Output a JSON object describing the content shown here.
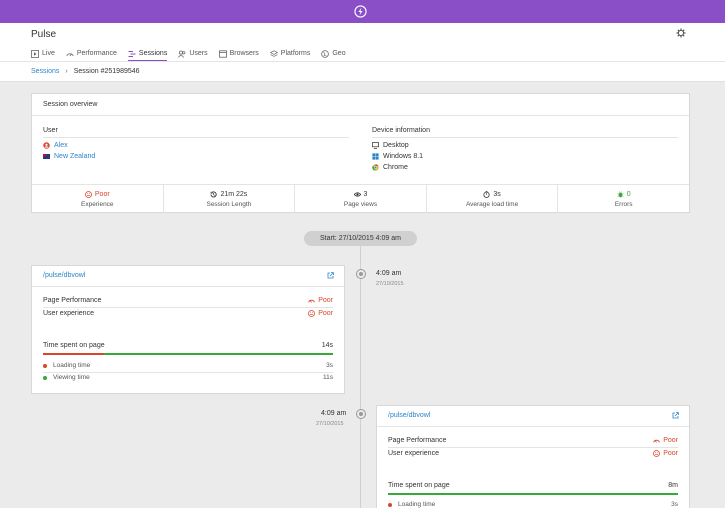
{
  "app": {
    "title": "Pulse"
  },
  "tabs": [
    {
      "label": "Live",
      "icon": "play-icon"
    },
    {
      "label": "Performance",
      "icon": "gauge-icon"
    },
    {
      "label": "Sessions",
      "icon": "sessions-icon",
      "active": true
    },
    {
      "label": "Users",
      "icon": "users-icon"
    },
    {
      "label": "Browsers",
      "icon": "browser-icon"
    },
    {
      "label": "Platforms",
      "icon": "platforms-icon"
    },
    {
      "label": "Geo",
      "icon": "globe-icon"
    }
  ],
  "breadcrumb": {
    "root": "Sessions",
    "current": "Session #251989546"
  },
  "overview": {
    "title": "Session overview",
    "user_label": "User",
    "user_name": "Alex",
    "user_country": "New Zealand",
    "device_label": "Device information",
    "device_type": "Desktop",
    "device_os": "Windows 8.1",
    "device_browser": "Chrome",
    "stats": [
      {
        "value": "Poor",
        "label": "Experience"
      },
      {
        "value": "21m 22s",
        "label": "Session Length"
      },
      {
        "value": "3",
        "label": "Page views"
      },
      {
        "value": "3s",
        "label": "Average load time"
      },
      {
        "value": "0",
        "label": "Errors"
      }
    ]
  },
  "timeline": {
    "start": "Start: 27/10/2015 4:09 am",
    "entries": [
      {
        "time": "4:09 am",
        "date": "27/10/2015",
        "path": "/pulse/dbvowl",
        "perf_label": "Page Performance",
        "perf_value": "Poor",
        "ux_label": "User experience",
        "ux_value": "Poor",
        "time_label": "Time spent on page",
        "time_value": "14s",
        "loading_fraction": 0.21,
        "loading_label": "Loading time",
        "loading_value": "3s",
        "viewing_label": "Viewing time",
        "viewing_value": "11s"
      },
      {
        "time": "4:09 am",
        "date": "27/10/2015",
        "path": "/pulse/dbvowl",
        "perf_label": "Page Performance",
        "perf_value": "Poor",
        "ux_label": "User experience",
        "ux_value": "Poor",
        "time_label": "Time spent on page",
        "time_value": "8m",
        "loading_fraction": 0.0,
        "loading_label": "Loading time",
        "loading_value": "3s"
      }
    ]
  },
  "colors": {
    "brand": "#8a4fc6",
    "link": "#2c85c9",
    "poor": "#d9452b",
    "good": "#38a83a"
  }
}
